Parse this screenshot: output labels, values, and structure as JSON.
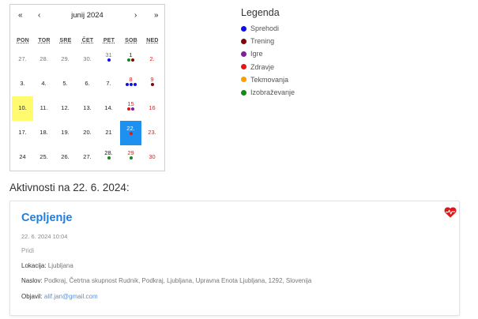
{
  "calendar": {
    "month_label": "junij 2024",
    "nav": {
      "prev_year": "«",
      "prev_month": "‹",
      "next_month": "›",
      "next_year": "»"
    },
    "weekdays": [
      "PON",
      "TOR",
      "SRE",
      "ČET",
      "PET",
      "SOB",
      "NED"
    ],
    "weeks": [
      [
        {
          "label": "27.",
          "muted": true,
          "dots": []
        },
        {
          "label": "28.",
          "muted": true,
          "dots": []
        },
        {
          "label": "29.",
          "muted": true,
          "dots": []
        },
        {
          "label": "30.",
          "muted": true,
          "dots": []
        },
        {
          "label": "31",
          "muted": true,
          "dots": [
            "sprehodi"
          ]
        },
        {
          "label": "1",
          "dots": [
            "izobrazevanje",
            "trening"
          ]
        },
        {
          "label": "2.",
          "sunday": true,
          "dots": []
        }
      ],
      [
        {
          "label": "3.",
          "dots": []
        },
        {
          "label": "4.",
          "dots": []
        },
        {
          "label": "5.",
          "dots": []
        },
        {
          "label": "6.",
          "dots": []
        },
        {
          "label": "7.",
          "dots": []
        },
        {
          "label": "8",
          "saturday_red": true,
          "dots": [
            "sprehodi",
            "sprehodi",
            "sprehodi"
          ]
        },
        {
          "label": "9",
          "sunday": true,
          "dots": [
            "trening"
          ]
        }
      ],
      [
        {
          "label": "10.",
          "today": true,
          "dots": []
        },
        {
          "label": "11.",
          "dots": []
        },
        {
          "label": "12.",
          "dots": []
        },
        {
          "label": "13.",
          "dots": []
        },
        {
          "label": "14.",
          "dots": []
        },
        {
          "label": "15",
          "saturday_red": true,
          "dots": [
            "zdravje",
            "igre"
          ]
        },
        {
          "label": "16",
          "sunday": true,
          "dots": []
        }
      ],
      [
        {
          "label": "17.",
          "dots": []
        },
        {
          "label": "18.",
          "dots": []
        },
        {
          "label": "19.",
          "dots": []
        },
        {
          "label": "20.",
          "dots": []
        },
        {
          "label": "21",
          "dots": []
        },
        {
          "label": "22.",
          "selected": true,
          "dots": [
            "zdravje"
          ]
        },
        {
          "label": "23.",
          "sunday": true,
          "dots": []
        }
      ],
      [
        {
          "label": "24",
          "dots": []
        },
        {
          "label": "25.",
          "dots": []
        },
        {
          "label": "26.",
          "dots": []
        },
        {
          "label": "27.",
          "dots": []
        },
        {
          "label": "28.",
          "dots": [
            "izobrazevanje"
          ]
        },
        {
          "label": "29",
          "saturday_red": true,
          "dots": [
            "izobrazevanje"
          ]
        },
        {
          "label": "30",
          "sunday": true,
          "dots": []
        }
      ]
    ]
  },
  "legend": {
    "title": "Legenda",
    "items": [
      {
        "key": "sprehodi",
        "label": "Sprehodi",
        "color": "#1010e0"
      },
      {
        "key": "trening",
        "label": "Trening",
        "color": "#7a0a0a"
      },
      {
        "key": "igre",
        "label": "Igre",
        "color": "#7d1fa0"
      },
      {
        "key": "zdravje",
        "label": "Zdravje",
        "color": "#e01818"
      },
      {
        "key": "tekmovanja",
        "label": "Tekmovanja",
        "color": "#f5a000"
      },
      {
        "key": "izobrazevanje",
        "label": "Izobraževanje",
        "color": "#138a13"
      }
    ]
  },
  "activities": {
    "heading": "Aktivnosti na 22. 6. 2024:",
    "card": {
      "title": "Cepljenje",
      "icon": "heart-pulse-icon",
      "icon_color": "#e01818",
      "datetime": "22. 6. 2024 10:04",
      "description": "Pridi",
      "location_label": "Lokacija:",
      "location_value": " Ljubljana",
      "address_label": "Naslov:",
      "address_value": " Podkraj, Četrtna skupnost Rudnik, Podkraj, Ljubljana, Upravna Enota Ljubljana, 1292, Slovenija",
      "author_label": "Objavil:",
      "author_value": "alif.jan@gmail.com"
    }
  }
}
